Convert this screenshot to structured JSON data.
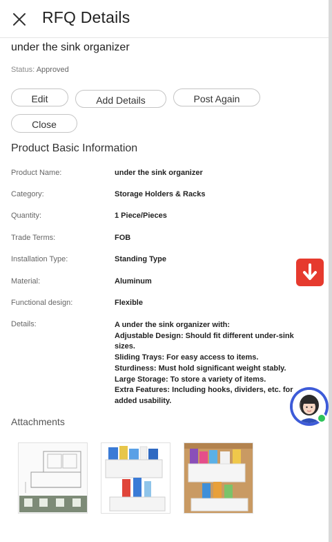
{
  "header": {
    "title": "RFQ Details",
    "close_icon": "close-icon"
  },
  "rfq": {
    "product_title": "under the sink organizer",
    "status_label": "Status:",
    "status_value": "Approved"
  },
  "actions": {
    "edit": "Edit",
    "add_details": "Add Details",
    "post_again": "Post Again",
    "close": "Close"
  },
  "basic_info": {
    "title": "Product Basic Information",
    "rows": [
      {
        "label": "Product Name:",
        "value": "under the sink organizer"
      },
      {
        "label": "Category:",
        "value": "Storage Holders & Racks"
      },
      {
        "label": "Quantity:",
        "value": "1 Piece/Pieces"
      },
      {
        "label": "Trade Terms:",
        "value": "FOB"
      },
      {
        "label": "Installation Type:",
        "value": "Standing Type"
      },
      {
        "label": "Material:",
        "value": "Aluminum"
      },
      {
        "label": "Functional design:",
        "value": "Flexible"
      }
    ],
    "details_label": "Details:",
    "details_lines": [
      "A under the sink organizer with:",
      "Adjustable Design: Should fit different under-sink",
      "sizes.",
      "Sliding Trays: For easy access to items.",
      "Sturdiness: Must hold significant weight stably.",
      "Large Storage: To store a variety of items.",
      "Extra Features: Including hooks, dividers, etc. for",
      "added usability."
    ]
  },
  "attachments": {
    "title": "Attachments",
    "count": 3
  },
  "floating": {
    "download_icon": "download-arrow-icon",
    "support_icon": "support-avatar-icon",
    "accent": "#e63a2e",
    "avatar_ring": "#3d5bd8",
    "online": "#2ec45a"
  }
}
